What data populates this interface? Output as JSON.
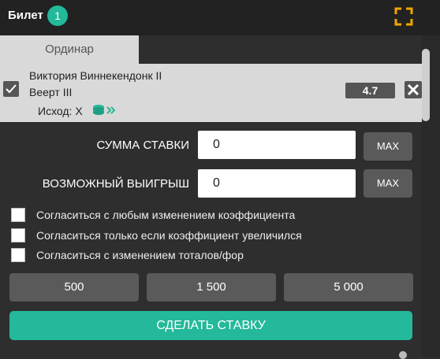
{
  "header": {
    "title": "Билет",
    "badge_count": "1",
    "expand_icon": "expand-icon",
    "accent": "#f0a500"
  },
  "tabs": [
    {
      "label": "Ординар",
      "active": true
    }
  ],
  "bet": {
    "team1": "Виктория Виннекендонк II",
    "team2": "Веерт III",
    "outcome": "Исход: X",
    "odds": "4.7",
    "check_icon": "checkmark-icon",
    "remove_icon": "close-icon",
    "coins_icon": "coins-icon"
  },
  "form": {
    "stake_label": "СУММА СТАВКИ",
    "stake_value": "0",
    "win_label": "ВОЗМОЖНЫЙ ВЫИГРЫШ",
    "win_value": "0",
    "max_label": "MAX"
  },
  "options": [
    {
      "label": "Согласиться с любым изменением коэффициента",
      "checked": false
    },
    {
      "label": "Согласиться только если коэффициент увеличился",
      "checked": false
    },
    {
      "label": "Согласиться с изменением тоталов/фор",
      "checked": false
    }
  ],
  "quick_amounts": [
    "500",
    "1 500",
    "5 000"
  ],
  "submit_label": "СДЕЛАТЬ СТАВКУ",
  "colors": {
    "primary": "#23b99a",
    "background": "#2e2e2e",
    "header": "#222222"
  }
}
